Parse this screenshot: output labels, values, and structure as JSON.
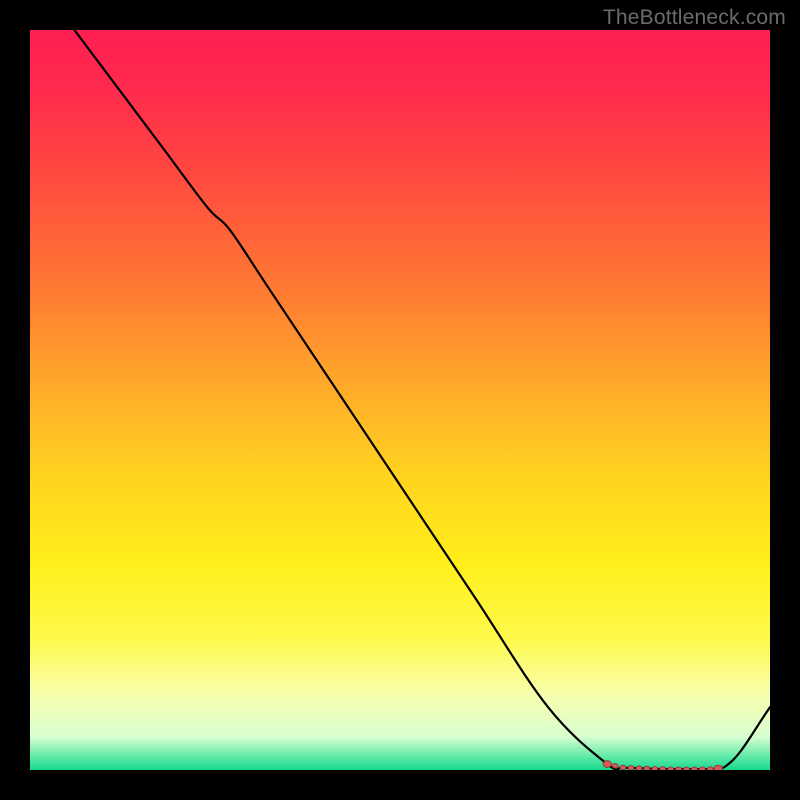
{
  "watermark": "TheBottleneck.com",
  "chart_data": {
    "type": "line",
    "title": "",
    "xlabel": "",
    "ylabel": "",
    "x_range": [
      0,
      100
    ],
    "y_range": [
      0,
      100
    ],
    "series": [
      {
        "name": "curve",
        "x": [
          6,
          12,
          18,
          24,
          27,
          32,
          40,
          50,
          60,
          70,
          78,
          80,
          82,
          84,
          86,
          88,
          90,
          92,
          93,
          94,
          96,
          99,
          100
        ],
        "y": [
          100,
          92,
          84,
          76,
          73,
          65.5,
          53.5,
          38.5,
          23.5,
          8.5,
          0.8,
          0.35,
          0.25,
          0.18,
          0.12,
          0.1,
          0.1,
          0.12,
          0.2,
          0.5,
          2.5,
          7,
          8.5
        ]
      }
    ],
    "optimal_band": {
      "from_x": 78,
      "to_x": 93
    },
    "gradient_stops": [
      {
        "offset": 0.0,
        "color": "#ff1f52"
      },
      {
        "offset": 0.08,
        "color": "#ff2a4d"
      },
      {
        "offset": 0.2,
        "color": "#ff4a3f"
      },
      {
        "offset": 0.35,
        "color": "#ff7a33"
      },
      {
        "offset": 0.5,
        "color": "#ffb028"
      },
      {
        "offset": 0.6,
        "color": "#ffd21f"
      },
      {
        "offset": 0.72,
        "color": "#ffef1a"
      },
      {
        "offset": 0.82,
        "color": "#fff94a"
      },
      {
        "offset": 0.9,
        "color": "#f7ffaf"
      },
      {
        "offset": 0.955,
        "color": "#d8ffcf"
      },
      {
        "offset": 0.985,
        "color": "#53e7a3"
      },
      {
        "offset": 1.0,
        "color": "#18d98e"
      }
    ],
    "dot_color": "#d85a5a",
    "dot_stroke": "#8e2f2f",
    "line_color": "#000000"
  }
}
